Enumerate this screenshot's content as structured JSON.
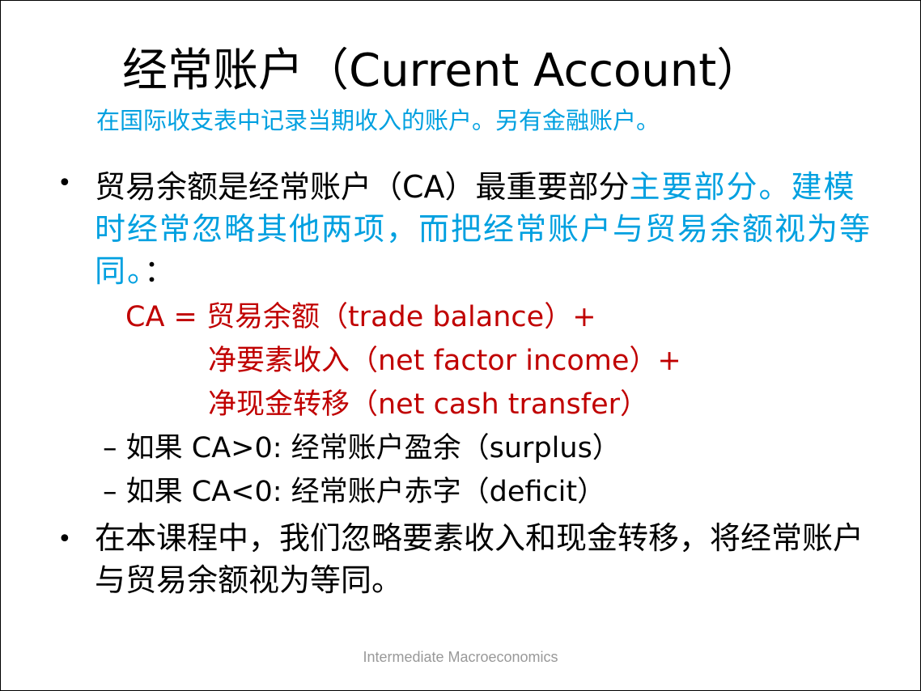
{
  "slide": {
    "title": "经常账户（Current Account）",
    "subtitle": "在国际收支表中记录当期收入的账户。另有金融账户。",
    "bullet1": {
      "text": "贸易余额是经常账户（CA）最重要部分",
      "note": "主要部分。建模时经常忽略其他两项，而把经常账户与贸易余额视为等同。",
      "suffix": "："
    },
    "formula": {
      "line1": "CA = 贸易余额（trade balance）+",
      "line2": "净要素收入（net factor income）+",
      "line3": "净现金转移（net cash transfer）"
    },
    "subbullets": [
      "– 如果 CA>0: 经常账户盈余（surplus）",
      "– 如果 CA<0: 经常账户赤字（deficit）"
    ],
    "bullet2": "在本课程中，我们忽略要素收入和现金转移，将经常账户与贸易余额视为等同。",
    "footer": "Intermediate Macroeconomics",
    "bullet_symbol": "•"
  },
  "colors": {
    "accent_blue": "#00a0e0",
    "formula_red": "#c00000",
    "footer_gray": "#999999"
  }
}
